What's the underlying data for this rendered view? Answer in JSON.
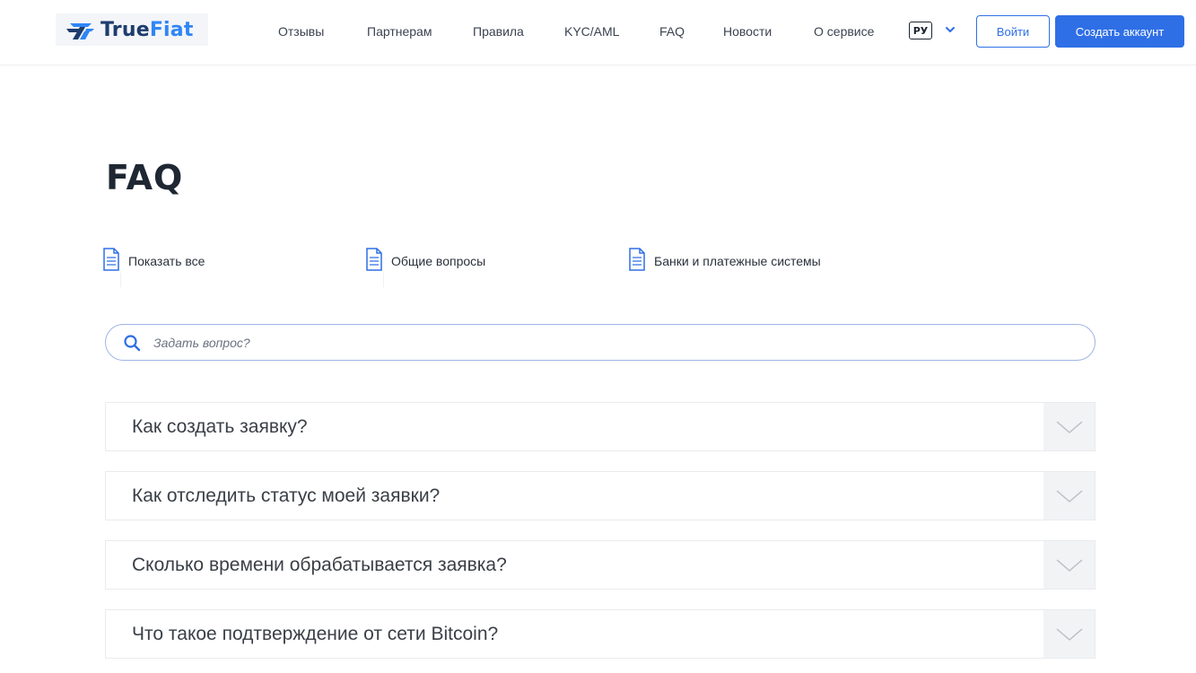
{
  "header": {
    "logo": {
      "part1": "True",
      "part2": "Fiat"
    },
    "nav": [
      "Отзывы",
      "Партнерам",
      "Правила",
      "KYC/AML",
      "FAQ",
      "Новости",
      "О сервисе"
    ],
    "lang": "РУ",
    "login_label": "Войти",
    "register_label": "Создать аккаунт"
  },
  "main": {
    "title": "FAQ",
    "categories": [
      "Показать все",
      "Общие вопросы",
      "Банки и платежные системы"
    ],
    "search": {
      "placeholder": "Задать вопрос?",
      "value": ""
    },
    "questions": [
      "Как создать заявку?",
      "Как отследить статус моей заявки?",
      "Сколько времени обрабатывается заявка?",
      "Что такое подтверждение от сети Bitcoin?"
    ]
  },
  "colors": {
    "accent": "#2f6fe6",
    "logo_dark": "#1e3c6e",
    "logo_light": "#2f86f6",
    "toggle_bg": "#f2f3f5"
  },
  "icons": [
    "logo-mark-icon",
    "chevron-down-icon",
    "document-icon",
    "search-icon"
  ]
}
